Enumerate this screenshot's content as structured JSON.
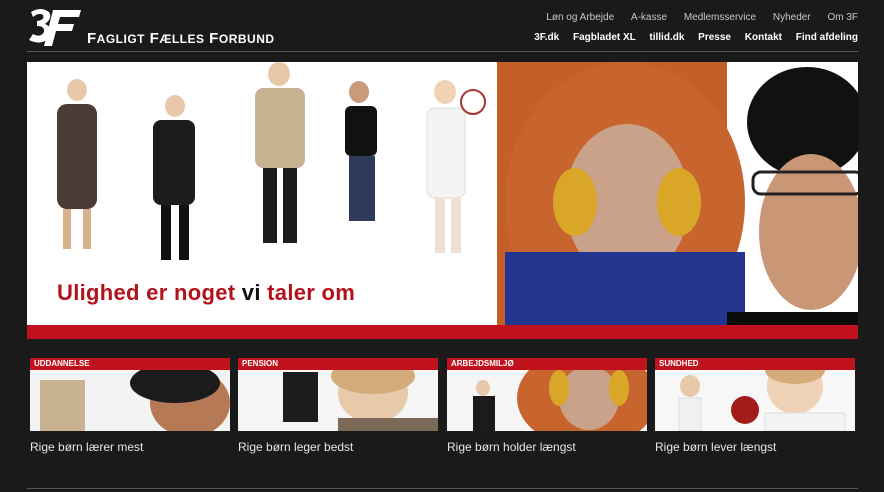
{
  "brand": {
    "prefix": "F",
    "name": "AGLIGT",
    "rest": "Fælles Forbund",
    "logo_text": "3F"
  },
  "topnav": [
    "Løn og Arbejde",
    "A-kasse",
    "Medlemsservice",
    "Nyheder",
    "Om 3F"
  ],
  "mainnav": [
    "3F.dk",
    "Fagbladet XL",
    "tillid.dk",
    "Presse",
    "Kontakt",
    "Find afdeling"
  ],
  "hero": {
    "tagline_1": "Ulighed er noget",
    "tagline_2": "vi",
    "tagline_3": "taler om"
  },
  "cards": [
    {
      "tag": "UDDANNELSE",
      "title": "Rige børn lærer mest"
    },
    {
      "tag": "PENSION",
      "title": "Rige børn leger bedst"
    },
    {
      "tag": "ARBEJDSMILJØ",
      "title": "Rige børn holder længst"
    },
    {
      "tag": "SUNDHED",
      "title": "Rige børn lever længst"
    }
  ],
  "colors": {
    "accent": "#c0121d",
    "bg": "#1a1a1a"
  }
}
